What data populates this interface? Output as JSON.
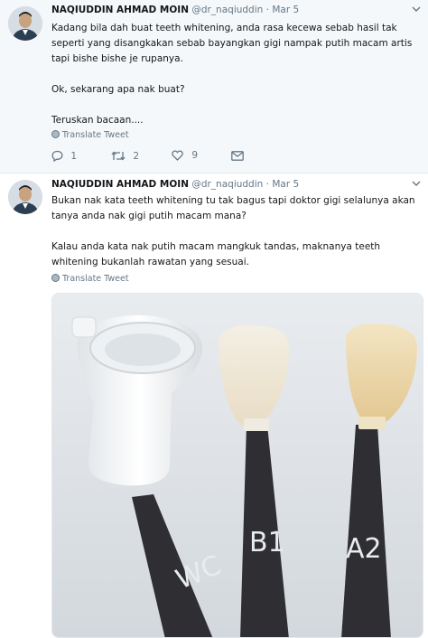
{
  "tweets": [
    {
      "author": "NAQIUDDIN AHMAD MOIN",
      "handle": "@dr_naqiuddin",
      "dot": "·",
      "date": "Mar 5",
      "body": [
        "Kadang bila dah buat teeth whitening, anda rasa kecewa sebab hasil tak seperti yang disangkakan sebab bayangkan gigi nampak putih macam artis tapi bishe bishe je rupanya.",
        "Ok, sekarang apa nak buat?",
        "Teruskan bacaan...."
      ],
      "translate": "Translate Tweet",
      "actions": {
        "replies": "1",
        "retweets": "2",
        "likes": "9"
      }
    },
    {
      "author": "NAQIUDDIN AHMAD MOIN",
      "handle": "@dr_naqiuddin",
      "dot": "·",
      "date": "Mar 5",
      "body": [
        "Bukan nak kata teeth whitening tu tak bagus tapi doktor gigi selalunya akan tanya anda nak gigi putih macam mana?",
        "Kalau anda kata nak putih macam mangkuk tandas, maknanya teeth whitening bukanlah rawatan yang sesuai."
      ],
      "translate": "Translate Tweet",
      "media": {
        "labels": [
          "WC",
          "B1",
          "A2"
        ]
      }
    }
  ],
  "icons": {
    "globe": "globe-icon",
    "reply": "reply-icon",
    "retweet": "retweet-icon",
    "like": "heart-icon",
    "dm": "envelope-icon",
    "more": "chevron-down-icon"
  },
  "colors": {
    "background_highlight": "#f5f8fa",
    "text_primary": "#14171a",
    "text_secondary": "#657786",
    "divider": "#e1e8ed"
  }
}
